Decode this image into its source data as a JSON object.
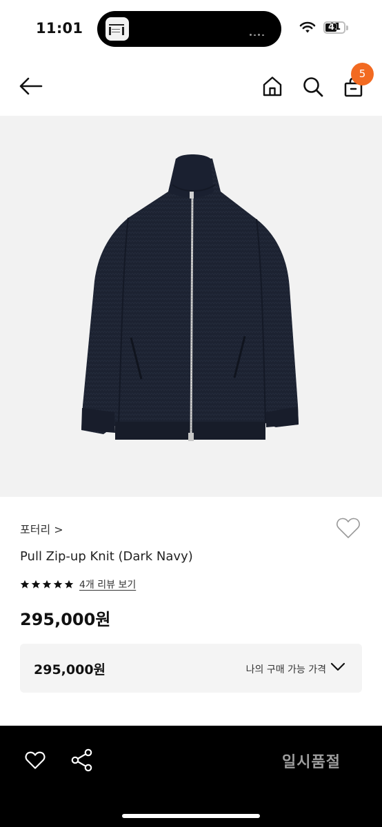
{
  "status_bar": {
    "time": "11:01",
    "battery": "41"
  },
  "header": {
    "cart_badge": "5"
  },
  "product": {
    "brand": "포터리",
    "brand_chevron": ">",
    "name": "Pull Zip-up Knit (Dark Navy)",
    "rating_stars": 5,
    "review_link": "4개 리뷰 보기",
    "price": "295,000원"
  },
  "price_box": {
    "value": "295,000원",
    "label": "나의 구매 가능 가격"
  },
  "bottom_bar": {
    "status_label": "일시품절"
  },
  "colors": {
    "badge": "#f26a21",
    "jacket": "#1c2231",
    "bottom_bar": "#000000",
    "soldout_text": "#9d9d9d"
  },
  "icons": [
    "back-arrow-icon",
    "home-icon",
    "search-icon",
    "bag-icon",
    "heart-icon",
    "star-icon",
    "chevron-down-icon",
    "share-icon"
  ]
}
